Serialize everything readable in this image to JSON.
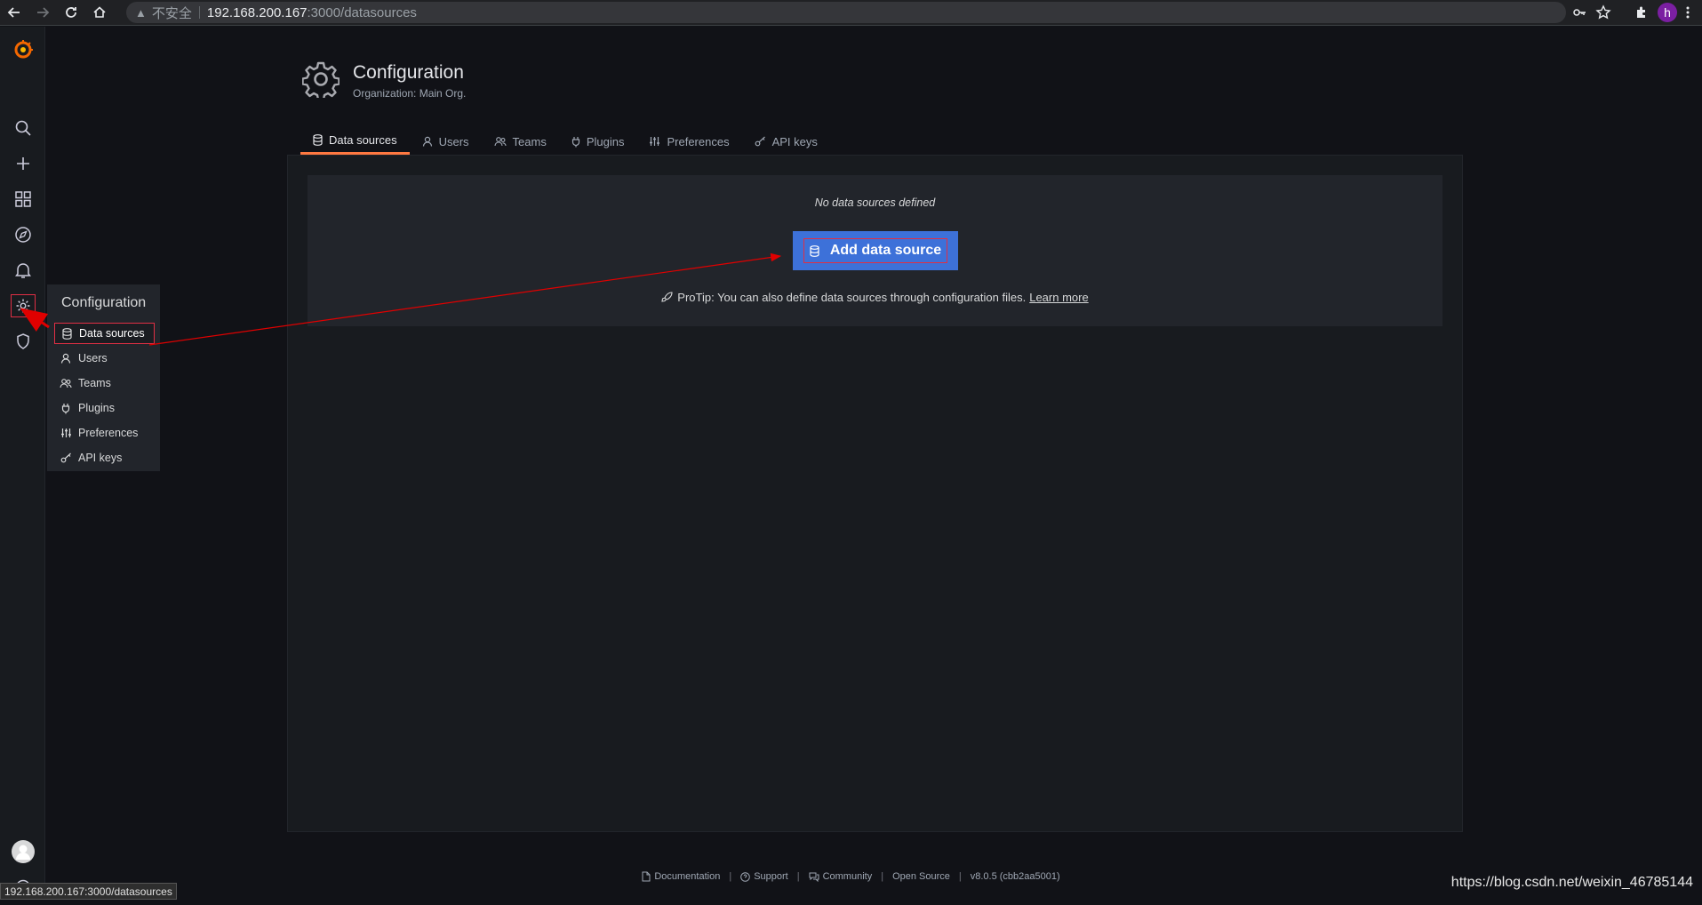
{
  "browser": {
    "insecure_label": "不安全",
    "url_host": "192.168.200.167",
    "url_path": ":3000/datasources",
    "profile_initial": "h"
  },
  "flyout": {
    "title": "Configuration",
    "items": [
      {
        "label": "Data sources",
        "icon": "database-icon"
      },
      {
        "label": "Users",
        "icon": "user-icon"
      },
      {
        "label": "Teams",
        "icon": "users-icon"
      },
      {
        "label": "Plugins",
        "icon": "plug-icon"
      },
      {
        "label": "Preferences",
        "icon": "sliders-icon"
      },
      {
        "label": "API keys",
        "icon": "key-icon"
      }
    ]
  },
  "header": {
    "title": "Configuration",
    "subtitle": "Organization: Main Org."
  },
  "tabs": [
    {
      "label": "Data sources",
      "active": true
    },
    {
      "label": "Users"
    },
    {
      "label": "Teams"
    },
    {
      "label": "Plugins"
    },
    {
      "label": "Preferences"
    },
    {
      "label": "API keys"
    }
  ],
  "empty": {
    "message": "No data sources defined",
    "button_label": "Add data source",
    "protip": "ProTip: You can also define data sources through configuration files.",
    "learn_more": "Learn more"
  },
  "footer": {
    "documentation": "Documentation",
    "support": "Support",
    "community": "Community",
    "open_source": "Open Source",
    "version": "v8.0.5 (cbb2aa5001)"
  },
  "status_url": "192.168.200.167:3000/datasources",
  "watermark": "https://blog.csdn.net/weixin_46785144",
  "colors": {
    "accent_orange": "#ff7941",
    "primary_blue": "#3d71d9",
    "annotation_red": "#e02f44"
  }
}
